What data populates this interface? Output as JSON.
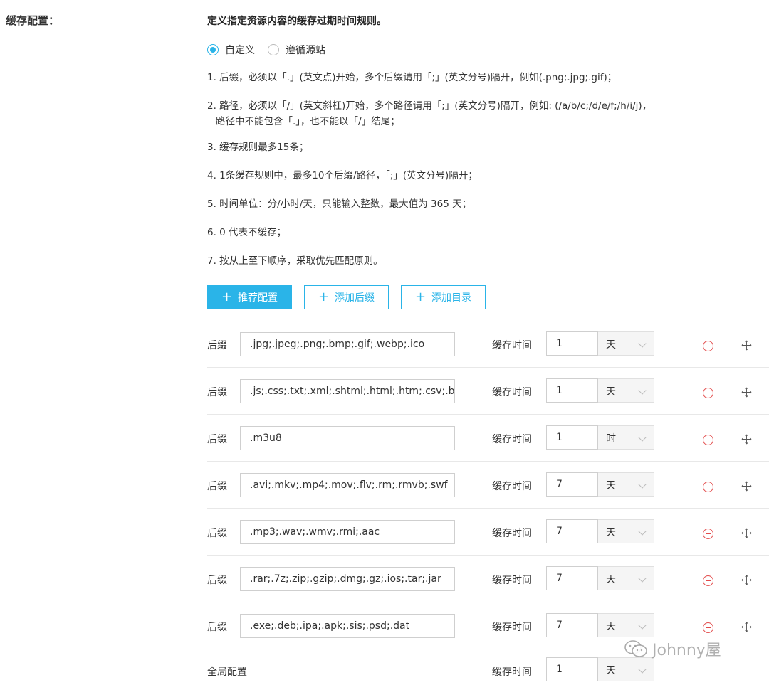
{
  "section_label": "缓存配置：",
  "description": "定义指定资源内容的缓存过期时间规则。",
  "radio_options": [
    {
      "label": "自定义",
      "checked": true
    },
    {
      "label": "遵循源站",
      "checked": false
    }
  ],
  "rules": [
    "1. 后缀，必须以「.」(英文点)开始，多个后缀请用「;」(英文分号)隔开，例如(.png;.jpg;.gif)；",
    "2. 路径，必须以「/」(英文斜杠)开始，多个路径请用「;」(英文分号)隔开，例如: (/a/b/c;/d/e/f;/h/i/j)，",
    "路径中不能包含「.」，也不能以「/」结尾；",
    "3. 缓存规则最多15条；",
    "4. 1条缓存规则中，最多10个后缀/路径，「;」(英文分号)隔开；",
    "5. 时间单位：分/小时/天，只能输入整数，最大值为 365 天；",
    "6. 0 代表不缓存；",
    "7. 按从上至下顺序，采取优先匹配原则。"
  ],
  "buttons": {
    "recommend": "推荐配置",
    "add_suffix": "添加后缀",
    "add_dir": "添加目录"
  },
  "plus_glyph": "+",
  "time_label": "缓存时间",
  "rows": [
    {
      "label": "后缀",
      "value": ".jpg;.jpeg;.png;.bmp;.gif;.webp;.ico",
      "time": "1",
      "unit": "天"
    },
    {
      "label": "后缀",
      "value": ".js;.css;.txt;.xml;.shtml;.html;.htm;.csv;.bat",
      "time": "1",
      "unit": "天"
    },
    {
      "label": "后缀",
      "value": ".m3u8",
      "time": "1",
      "unit": "时"
    },
    {
      "label": "后缀",
      "value": ".avi;.mkv;.mp4;.mov;.flv;.rm;.rmvb;.swf",
      "time": "7",
      "unit": "天"
    },
    {
      "label": "后缀",
      "value": ".mp3;.wav;.wmv;.rmi;.aac",
      "time": "7",
      "unit": "天"
    },
    {
      "label": "后缀",
      "value": ".rar;.7z;.zip;.gzip;.dmg;.gz;.ios;.tar;.jar",
      "time": "7",
      "unit": "天"
    },
    {
      "label": "后缀",
      "value": ".exe;.deb;.ipa;.apk;.sis;.psd;.dat",
      "time": "7",
      "unit": "天"
    }
  ],
  "global": {
    "label": "全局配置",
    "time": "1",
    "unit": "天"
  },
  "watermark": "Johnny屋",
  "colors": {
    "accent": "#2ab4e8",
    "danger": "#e24b4b"
  },
  "icons": [
    "plus-icon",
    "remove-icon",
    "move-icon",
    "chevron-down-icon",
    "wechat-icon"
  ]
}
